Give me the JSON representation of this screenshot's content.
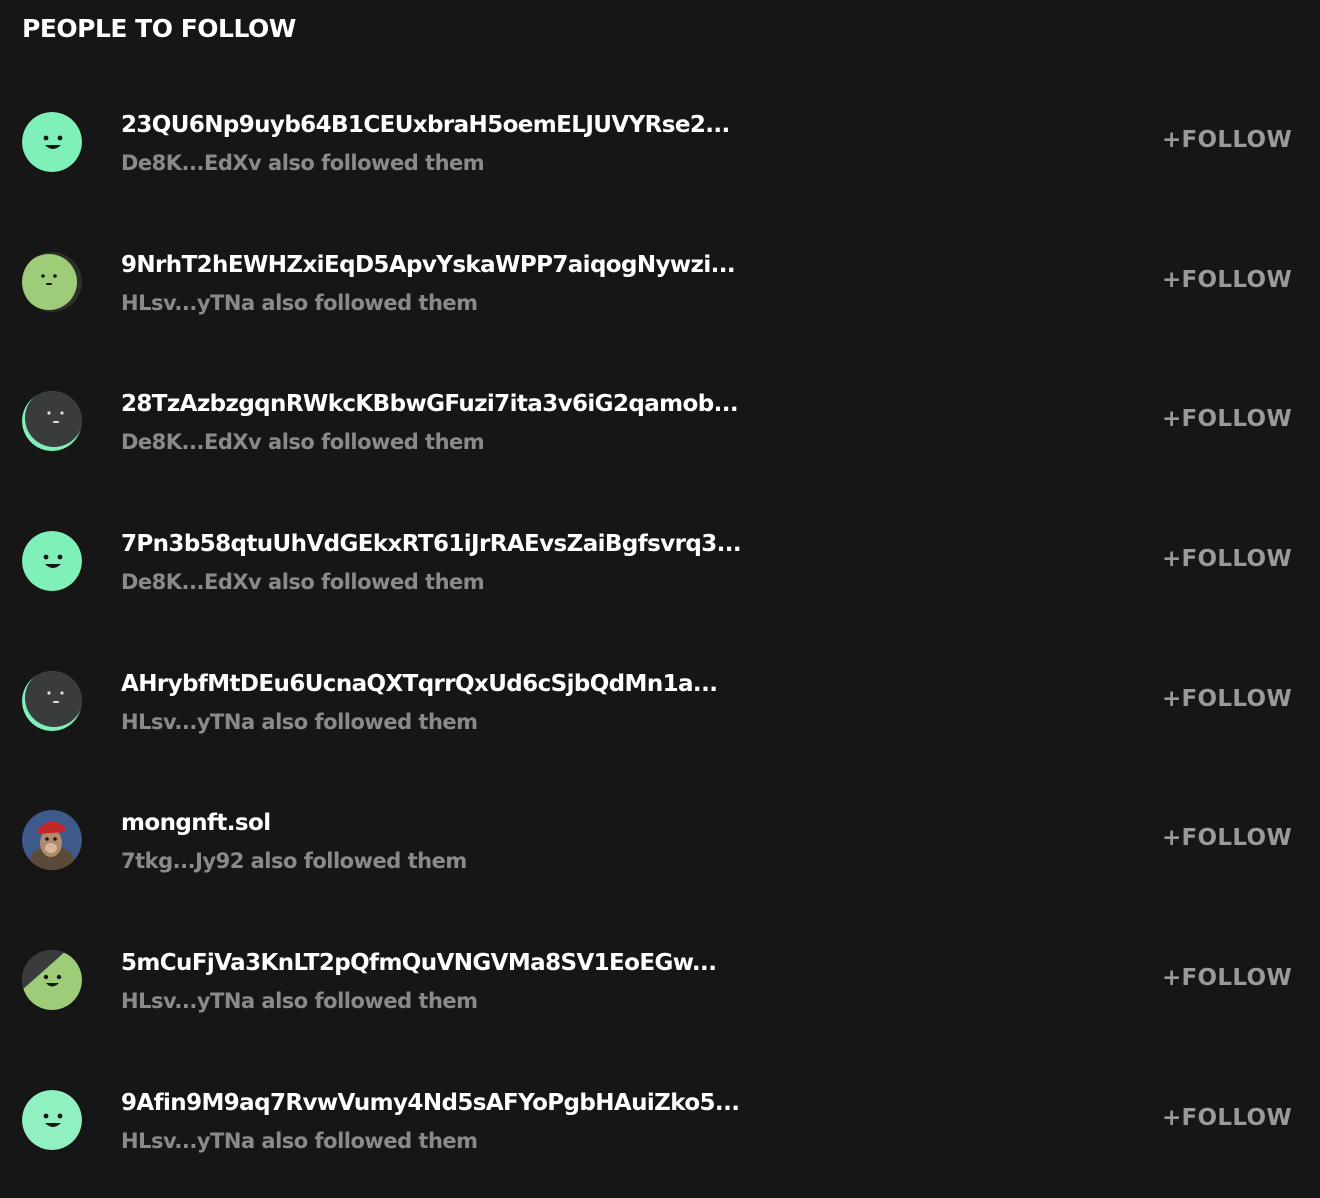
{
  "section_title": "PEOPLE TO FOLLOW",
  "people": [
    {
      "name": "23QU6Np9uyb64B1CEUxbraH5oemELJUVYRse2...",
      "mutual": "De8K...EdXv also followed them",
      "follow_label": "+FOLLOW",
      "avatar": {
        "style": "bright-smile",
        "color": "#7ef0b8",
        "face": "smile"
      }
    },
    {
      "name": "9NrhT2hEWHZxiEqD5ApvYskaWPP7aiqogNywzi...",
      "mutual": "HLsv...yTNa also followed them",
      "follow_label": "+FOLLOW",
      "avatar": {
        "style": "olive-neutral",
        "color": "#9fcc78",
        "face": "neutral"
      }
    },
    {
      "name": "28TzAzbzgqnRWkcKBbwGFuzi7ita3v6iG2qamob...",
      "mutual": "De8K...EdXv also followed them",
      "follow_label": "+FOLLOW",
      "avatar": {
        "style": "dark-mint",
        "color": "#3a3b3d",
        "face": "neutral"
      }
    },
    {
      "name": "7Pn3b58qtuUhVdGEkxRT61iJrRAEvsZaiBgfsvrq3...",
      "mutual": "De8K...EdXv also followed them",
      "follow_label": "+FOLLOW",
      "avatar": {
        "style": "bright-smile",
        "color": "#7ef0b8",
        "face": "smile"
      }
    },
    {
      "name": "AHrybfMtDEu6UcnaQXTqrrQxUd6cSjbQdMn1a...",
      "mutual": "HLsv...yTNa also followed them",
      "follow_label": "+FOLLOW",
      "avatar": {
        "style": "dark-mint",
        "color": "#3a3b3d",
        "face": "neutral"
      }
    },
    {
      "name": "mongnft.sol",
      "mutual": "7tkg...Jy92 also followed them",
      "follow_label": "+FOLLOW",
      "avatar": {
        "style": "photo-ape",
        "color": "#3e5a8a",
        "face": "ape"
      }
    },
    {
      "name": "5mCuFjVa3KnLT2pQfmQuVNGVMa8SV1EoEGw...",
      "mutual": "HLsv...yTNa also followed them",
      "follow_label": "+FOLLOW",
      "avatar": {
        "style": "olive-dark",
        "color": "#9fcc78",
        "face": "smile"
      }
    },
    {
      "name": "9Afin9M9aq7RvwVumy4Nd5sAFYoPgbHAuiZko5...",
      "mutual": "HLsv...yTNa also followed them",
      "follow_label": "+FOLLOW",
      "avatar": {
        "style": "bright-smile",
        "color": "#90f0c0",
        "face": "smile"
      }
    }
  ],
  "colors": {
    "background": "#161617",
    "name_text": "#ffffff",
    "mutual_text": "#8a8a8d",
    "follow_text": "#9a9a9d"
  }
}
